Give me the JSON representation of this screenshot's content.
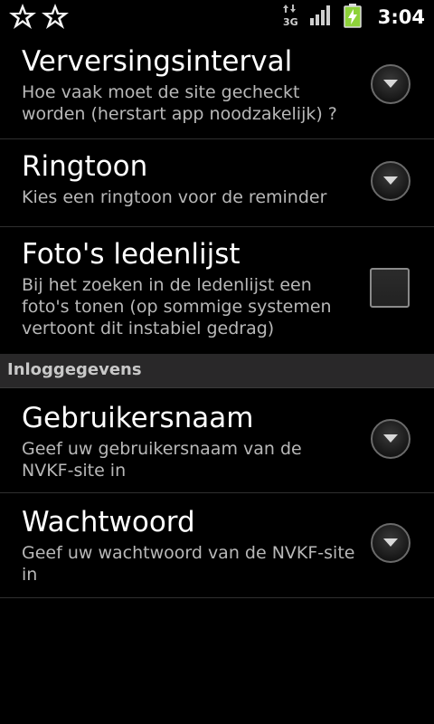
{
  "status_bar": {
    "time": "3:04",
    "network_label": "3G",
    "icons": [
      "star-notification-icon",
      "star-notification-icon",
      "network-3g-icon",
      "signal-strength-icon",
      "battery-charging-icon"
    ],
    "accent_colors": {
      "battery": "#8ed23a"
    }
  },
  "preferences": [
    {
      "title": "Verversingsinterval",
      "summary": "Hoe vaak moet de site gecheckt worden (herstart app noodzakelijk) ?",
      "widget": "dropdown"
    },
    {
      "title": "Ringtoon",
      "summary": "Kies een ringtoon voor de reminder",
      "widget": "dropdown"
    },
    {
      "title": "Foto's ledenlijst",
      "summary": "Bij het zoeken in de ledenlijst een foto's tonen (op sommige systemen vertoont dit instabiel gedrag)",
      "widget": "checkbox",
      "checked": false
    }
  ],
  "category": {
    "label": "Inloggegevens"
  },
  "login_preferences": [
    {
      "title": "Gebruikersnaam",
      "summary": "Geef uw gebruikersnaam van de NVKF-site in",
      "widget": "dropdown"
    },
    {
      "title": "Wachtwoord",
      "summary": "Geef uw wachtwoord van de NVKF-site in",
      "widget": "dropdown"
    }
  ]
}
